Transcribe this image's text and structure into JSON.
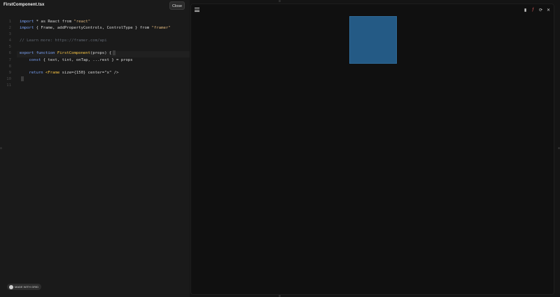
{
  "editor": {
    "file_name": "FirstComponent.tsx",
    "close_label": "Close"
  },
  "code_lines": [
    {
      "n": "1",
      "parts": [
        {
          "t": "import",
          "c": "kw"
        },
        {
          "t": " * as React from ",
          "c": "id"
        },
        {
          "t": "\"react\"",
          "c": "str"
        }
      ]
    },
    {
      "n": "2",
      "parts": [
        {
          "t": "import",
          "c": "kw"
        },
        {
          "t": " { Frame, addPropertyControls, ControlType } from ",
          "c": "id"
        },
        {
          "t": "\"framer\"",
          "c": "str"
        }
      ]
    },
    {
      "n": "3",
      "parts": []
    },
    {
      "n": "4",
      "parts": [
        {
          "t": "// Learn more: https://framer.com/api",
          "c": "cmt"
        }
      ]
    },
    {
      "n": "5",
      "parts": []
    },
    {
      "n": "6",
      "parts": [
        {
          "t": "export function ",
          "c": "kw"
        },
        {
          "t": "FirstComponent",
          "c": "fn"
        },
        {
          "t": "(props) {",
          "c": "id"
        }
      ]
    },
    {
      "n": "7",
      "parts": [
        {
          "t": "    const ",
          "c": "kw"
        },
        {
          "t": "{ text, tint, onTap, ...rest } = props",
          "c": "id"
        }
      ]
    },
    {
      "n": "8",
      "parts": []
    },
    {
      "n": "9",
      "parts": [
        {
          "t": "    return ",
          "c": "kw"
        },
        {
          "t": "<Frame ",
          "c": "tag"
        },
        {
          "t": "size={150} center=\"x\" />",
          "c": "id"
        }
      ]
    },
    {
      "n": "10",
      "parts": [
        {
          "t": "}",
          "c": "id"
        }
      ]
    },
    {
      "n": "11",
      "parts": []
    }
  ],
  "badge": {
    "label": "MADE WITH GRID"
  },
  "preview": {
    "menu_icon": "hamburger-icon",
    "toolbar_icons": [
      "file-icon",
      "framer-icon",
      "refresh-icon",
      "close-icon"
    ],
    "frame_color": "#245a85"
  }
}
